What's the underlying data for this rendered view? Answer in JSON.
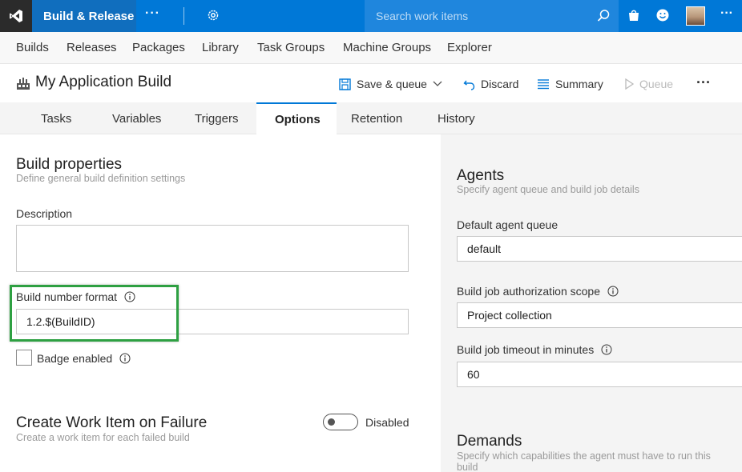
{
  "topbar": {
    "hub_title": "Build & Release",
    "more_glyph": "···",
    "search_placeholder": "Search work items",
    "icons": [
      "vs-logo-icon",
      "gear-icon",
      "search-icon",
      "shopping-bag-icon",
      "smiley-icon",
      "more-icon"
    ],
    "accent_color": "#0078d7"
  },
  "hubnav": {
    "items": [
      "Builds",
      "Releases",
      "Packages",
      "Library",
      "Task Groups",
      "Machine Groups",
      "Explorer"
    ]
  },
  "definition": {
    "title": "My Application Build",
    "toolbar": {
      "save_queue": "Save & queue",
      "discard": "Discard",
      "summary": "Summary",
      "queue": "Queue",
      "more": "···"
    }
  },
  "tabs": {
    "items": [
      "Tasks",
      "Variables",
      "Triggers",
      "Options",
      "Retention",
      "History"
    ],
    "active": "Options"
  },
  "build_properties": {
    "title": "Build properties",
    "subtitle": "Define general build definition settings",
    "description_label": "Description",
    "description_value": "",
    "build_number_label": "Build number format",
    "build_number_value": "1.2.$(BuildID)",
    "badge_label": "Badge enabled",
    "badge_checked": false
  },
  "work_item": {
    "title": "Create Work Item on Failure",
    "subtitle": "Create a work item for each failed build",
    "toggle_label": "Disabled",
    "toggle_on": false
  },
  "agents": {
    "title": "Agents",
    "subtitle": "Specify agent queue and build job details",
    "queue_label": "Default agent queue",
    "queue_value": "default",
    "scope_label": "Build job authorization scope",
    "scope_value": "Project collection",
    "timeout_label": "Build job timeout in minutes",
    "timeout_value": "60"
  },
  "demands": {
    "title": "Demands",
    "subtitle_line1": "Specify which capabilities the agent must have to run this",
    "subtitle_line2": "build"
  }
}
